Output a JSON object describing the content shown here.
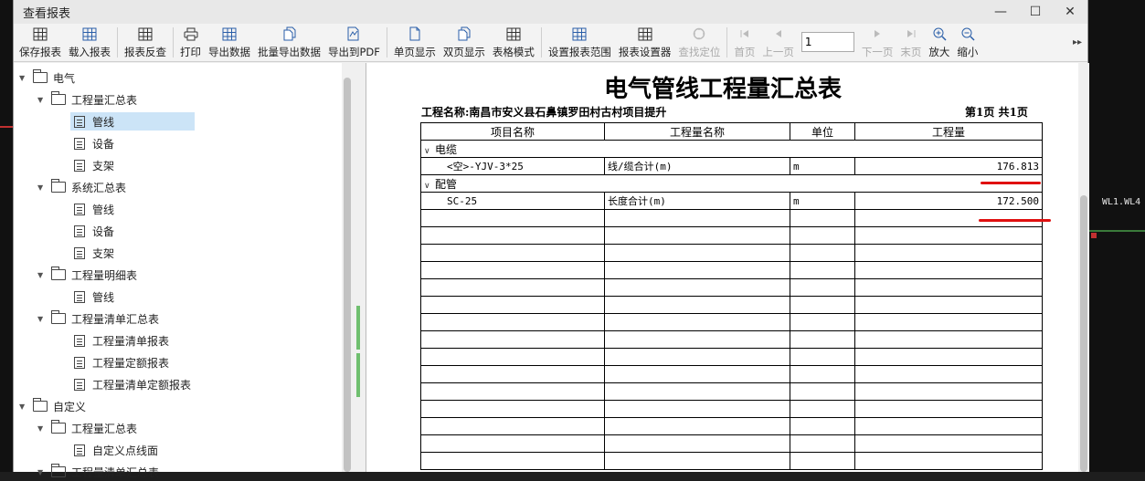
{
  "window": {
    "title": "查看报表",
    "controls": [
      "—",
      "☐",
      "✕"
    ]
  },
  "toolbar": {
    "buttons": [
      {
        "label": "保存报表",
        "icon": "save-grid-icon"
      },
      {
        "label": "载入报表",
        "icon": "load-grid-icon"
      },
      {
        "label": "报表反查",
        "icon": "reverse-lookup-icon"
      },
      {
        "label": "打印",
        "icon": "printer-icon"
      },
      {
        "label": "导出数据",
        "icon": "export-data-icon"
      },
      {
        "label": "批量导出数据",
        "icon": "batch-export-icon"
      },
      {
        "label": "导出到PDF",
        "icon": "pdf-export-icon"
      },
      {
        "label": "单页显示",
        "icon": "single-page-icon"
      },
      {
        "label": "双页显示",
        "icon": "double-page-icon"
      },
      {
        "label": "表格模式",
        "icon": "table-mode-icon"
      },
      {
        "label": "设置报表范围",
        "icon": "report-range-icon"
      },
      {
        "label": "报表设置器",
        "icon": "report-settings-icon"
      },
      {
        "label": "查找定位",
        "icon": "locate-icon"
      },
      {
        "label": "首页",
        "icon": "first-page-icon"
      },
      {
        "label": "上一页",
        "icon": "prev-page-icon"
      },
      {
        "label": "下一页",
        "icon": "next-page-icon"
      },
      {
        "label": "末页",
        "icon": "last-page-icon"
      },
      {
        "label": "放大",
        "icon": "zoom-in-icon"
      },
      {
        "label": "缩小",
        "icon": "zoom-out-icon"
      }
    ],
    "page_input": "1",
    "more": "▸▸"
  },
  "tree": [
    {
      "label": "电气",
      "type": "folder",
      "level": 0
    },
    {
      "label": "工程量汇总表",
      "type": "folder",
      "level": 1
    },
    {
      "label": "管线",
      "type": "doc",
      "level": 2,
      "selected": true
    },
    {
      "label": "设备",
      "type": "doc",
      "level": 2
    },
    {
      "label": "支架",
      "type": "doc",
      "level": 2
    },
    {
      "label": "系统汇总表",
      "type": "folder",
      "level": 1
    },
    {
      "label": "管线",
      "type": "doc",
      "level": 2
    },
    {
      "label": "设备",
      "type": "doc",
      "level": 2
    },
    {
      "label": "支架",
      "type": "doc",
      "level": 2
    },
    {
      "label": "工程量明细表",
      "type": "folder",
      "level": 1
    },
    {
      "label": "管线",
      "type": "doc",
      "level": 2
    },
    {
      "label": "工程量清单汇总表",
      "type": "folder",
      "level": 1
    },
    {
      "label": "工程量清单报表",
      "type": "doc",
      "level": 2
    },
    {
      "label": "工程量定额报表",
      "type": "doc",
      "level": 2
    },
    {
      "label": "工程量清单定额报表",
      "type": "doc",
      "level": 2
    },
    {
      "label": "自定义",
      "type": "folder",
      "level": 0
    },
    {
      "label": "工程量汇总表",
      "type": "folder",
      "level": 1
    },
    {
      "label": "自定义点线面",
      "type": "doc",
      "level": 2
    },
    {
      "label": "工程量清单汇总表",
      "type": "folder",
      "level": 1
    }
  ],
  "report": {
    "title": "电气管线工程量汇总表",
    "project_label": "工程名称:南昌市安义县石鼻镇罗田村古村项目提升",
    "page_info": "第1页 共1页",
    "headers": [
      "项目名称",
      "工程量名称",
      "单位",
      "工程量"
    ],
    "groups": [
      {
        "name": "电缆",
        "rows": [
          {
            "item": "<空>-YJV-3*25",
            "qty_name": "线/缆合计(m)",
            "unit": "m",
            "qty": "176.813"
          }
        ]
      },
      {
        "name": "配管",
        "rows": [
          {
            "item": "SC-25",
            "qty_name": "长度合计(m)",
            "unit": "m",
            "qty": "172.500"
          }
        ]
      }
    ],
    "empty_rows": 15
  },
  "background": {
    "cad_label": "WL1.WL4"
  },
  "colors": {
    "annotation_red": "#e01010",
    "selection": "#cce4f7",
    "splitter_green": "#6fbf6f"
  }
}
